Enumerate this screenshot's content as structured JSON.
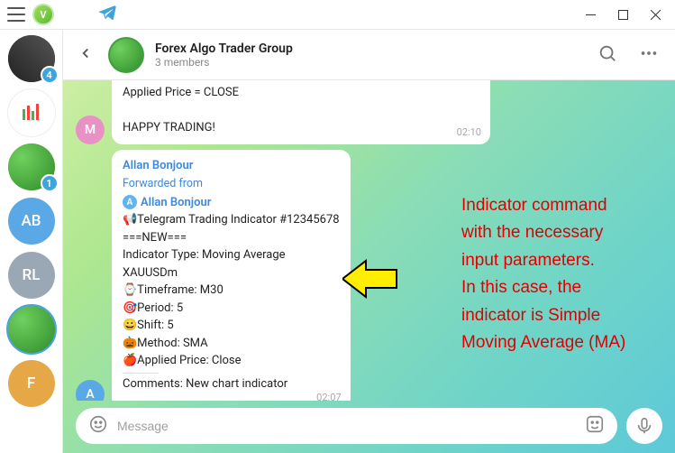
{
  "titlebar": {
    "account_letter": "V"
  },
  "sidebar": {
    "items": [
      {
        "badge": "4",
        "type": "image",
        "bg": "#333"
      },
      {
        "type": "icon-candles",
        "bg": "#fff"
      },
      {
        "type": "pepe-dog",
        "badge": "1",
        "bg": "#4aa84a"
      },
      {
        "letters": "AB",
        "bg": "#5aa9e6"
      },
      {
        "letters": "RL",
        "bg": "#9aa8b5"
      },
      {
        "type": "pepe",
        "bg": "#3fa03b",
        "active": true
      },
      {
        "letters": "F",
        "bg": "#e6a847"
      }
    ]
  },
  "header": {
    "group_name": "Forex Algo Trader Group",
    "members": "3 members"
  },
  "messages": {
    "top": {
      "avatar_letter": "M",
      "avatar_bg": "#e891c5",
      "lines": [
        "Applied Price = CLOSE",
        "",
        "HAPPY TRADING!"
      ],
      "time": "02:10"
    },
    "main": {
      "avatar_letter": "A",
      "avatar_bg": "#5aa9e6",
      "sender": "Allan Bonjour",
      "fwd_label": "Forwarded from",
      "fwd_name": "Allan Bonjour",
      "fwd_ava_letter": "A",
      "body": [
        "📢Telegram Trading Indicator #12345678",
        "===NEW===",
        "Indicator Type: Moving Average",
        "XAUUSDm",
        "⌚Timeframe: M30",
        "🎯Period: 5",
        "😀Shift: 5",
        "🎃Method: SMA",
        "🍎Applied Price: Close"
      ],
      "comment": "Comments: New chart indicator",
      "time": "02:07"
    }
  },
  "input": {
    "placeholder": "Message"
  },
  "annotation": {
    "lines": [
      "Indicator command",
      "with the necessary",
      "input parameters.",
      "In this case, the",
      "indicator is Simple",
      "Moving Average (MA)"
    ]
  }
}
